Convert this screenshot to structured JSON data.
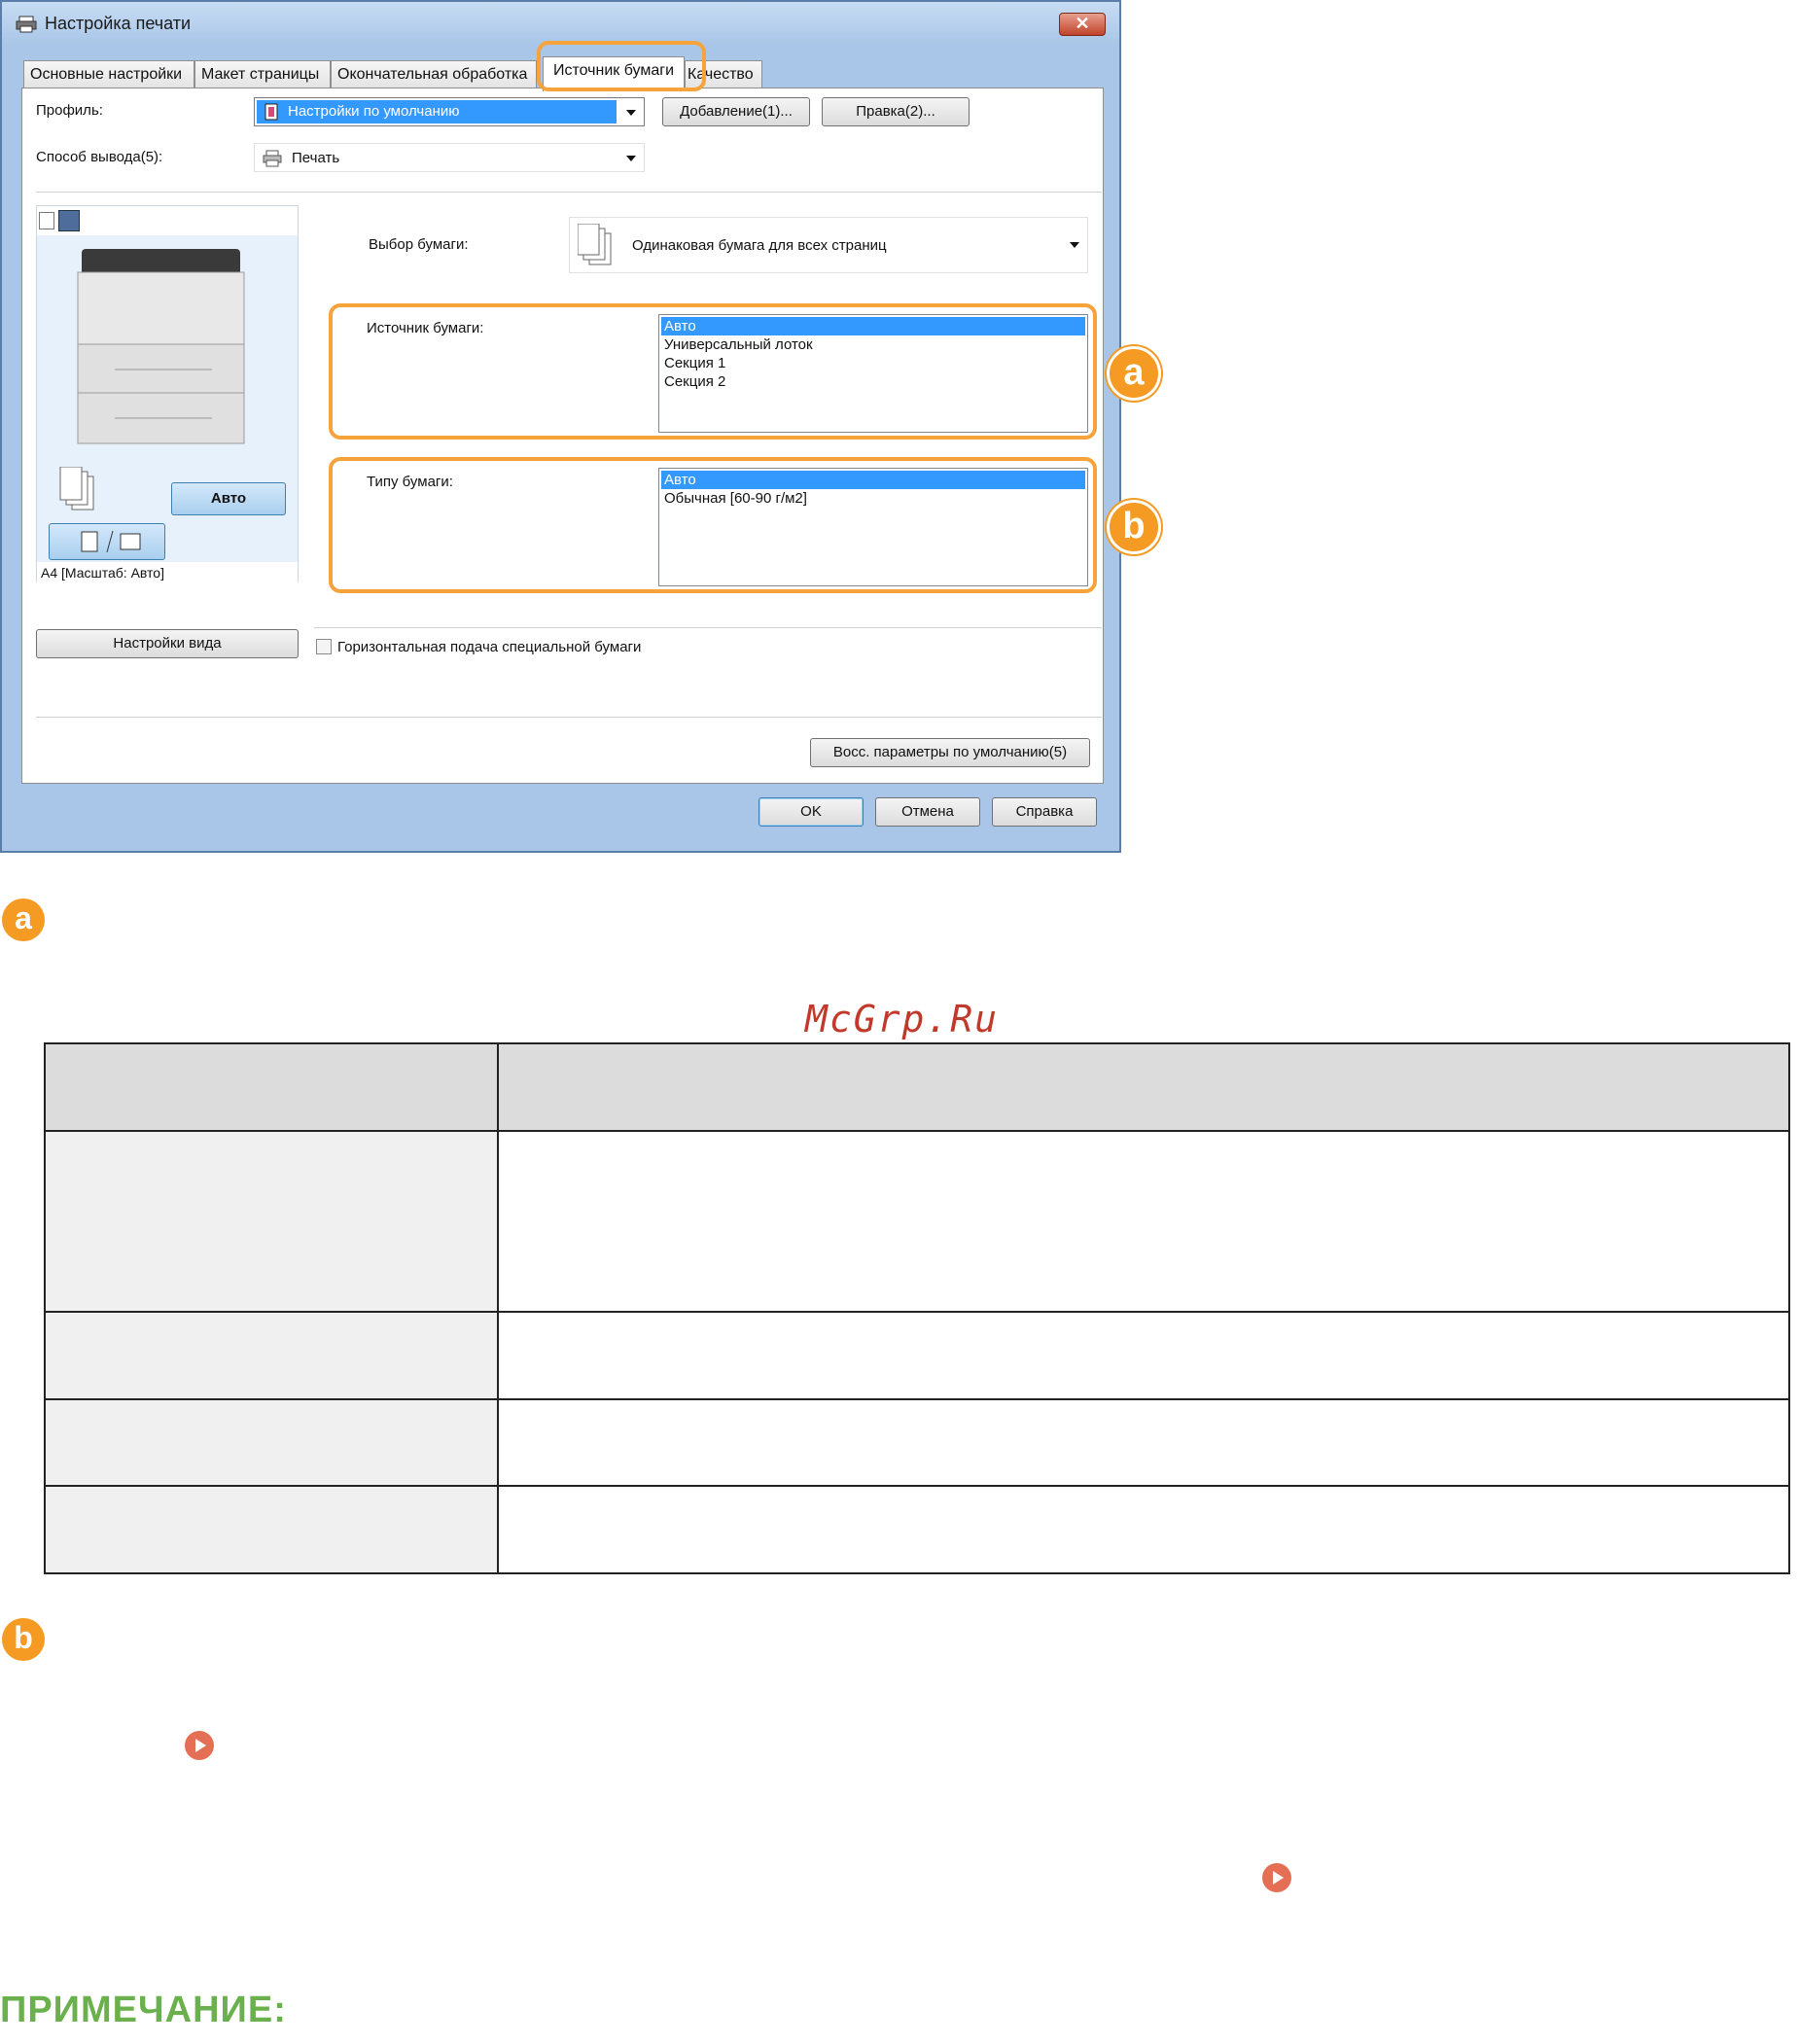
{
  "dialog": {
    "title": "Настройка печати",
    "close_label": "✕",
    "tabs": [
      "Основные настройки",
      "Макет страницы",
      "Окончательная обработка",
      "Источник бумаги",
      "Качество"
    ],
    "active_tab": "Источник бумаги",
    "profile_label": "Профиль:",
    "profile_value": "Настройки по умолчанию",
    "add_button": "Добавление(1)...",
    "edit_button": "Правка(2)...",
    "output_label": "Способ вывода(5):",
    "output_value": "Печать",
    "paper_selection_label": "Выбор бумаги:",
    "paper_selection_value": "Одинаковая бумага для всех страниц",
    "paper_source_label": "Источник бумаги:",
    "paper_source_options": [
      "Авто",
      "Универсальный лоток",
      "Секция 1",
      "Секция 2"
    ],
    "paper_type_label": "Типу бумаги:",
    "paper_type_options": [
      "Авто",
      "Обычная [60-90 г/м2]"
    ],
    "preview_auto_button": "Авто",
    "preview_caption": "А4 [Масштаб: Авто]",
    "view_settings_button": "Настройки вида",
    "horizontal_feed_label": "Горизонтальная подача специальной бумаги",
    "restore_defaults_button": "Восс. параметры по умолчанию(5)",
    "ok_button": "OK",
    "cancel_button": "Отмена",
    "help_button": "Справка",
    "callout_a": "a",
    "callout_b": "b"
  },
  "document": {
    "badge_a": "a",
    "badge_b": "b",
    "watermark": "McGrp.Ru",
    "note_title": "ПРИМЕЧАНИЕ:"
  },
  "colors": {
    "accent_orange": "#f59a23",
    "link_red": "#e46f55",
    "note_green": "#6ab04c",
    "selection_blue": "#3399ff"
  }
}
